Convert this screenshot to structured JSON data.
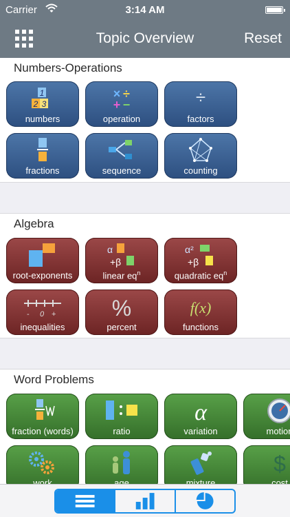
{
  "status_bar": {
    "carrier": "Carrier",
    "time": "3:14 AM"
  },
  "nav": {
    "title": "Topic Overview",
    "reset_label": "Reset"
  },
  "sections": [
    {
      "title": "Numbers-Operations",
      "color": "blue",
      "tiles": [
        {
          "label": "numbers",
          "icon": "numbers-icon"
        },
        {
          "label": "operation",
          "icon": "operation-icon"
        },
        {
          "label": "factors",
          "icon": "factors-icon"
        },
        {
          "label": "fractions",
          "icon": "fractions-icon"
        },
        {
          "label": "sequence",
          "icon": "sequence-icon"
        },
        {
          "label": "counting",
          "icon": "counting-icon"
        }
      ]
    },
    {
      "title": "Algebra",
      "color": "red",
      "tiles": [
        {
          "label": "root-exponents",
          "icon": "root-exponents-icon"
        },
        {
          "label": "linear eq",
          "superscript": "n",
          "icon": "linear-equation-icon"
        },
        {
          "label": "quadratic eq",
          "superscript": "n",
          "icon": "quadratic-equation-icon"
        },
        {
          "label": "inequalities",
          "icon": "inequalities-icon"
        },
        {
          "label": "percent",
          "icon": "percent-icon"
        },
        {
          "label": "functions",
          "icon": "functions-icon"
        }
      ]
    },
    {
      "title": "Word Problems",
      "color": "green",
      "tiles": [
        {
          "label": "fraction (words)",
          "icon": "fraction-words-icon"
        },
        {
          "label": "ratio",
          "icon": "ratio-icon"
        },
        {
          "label": "variation",
          "icon": "variation-icon"
        },
        {
          "label": "motion",
          "icon": "motion-icon"
        },
        {
          "label": "work",
          "icon": "work-gears-icon"
        },
        {
          "label": "age",
          "icon": "age-people-icon"
        },
        {
          "label": "mixture",
          "icon": "mixture-icon"
        },
        {
          "label": "cost",
          "icon": "cost-dollar-icon"
        }
      ]
    }
  ],
  "tab_bar": {
    "segments": [
      {
        "icon": "list-icon",
        "active": true
      },
      {
        "icon": "bar-chart-icon",
        "active": false
      },
      {
        "icon": "pie-chart-icon",
        "active": false
      }
    ]
  },
  "colors": {
    "nav": "#6e7a84",
    "blue_tile": "#3b6294",
    "red_tile": "#8a3636",
    "green_tile": "#4a8c3c",
    "accent": "#1a8fe8"
  }
}
